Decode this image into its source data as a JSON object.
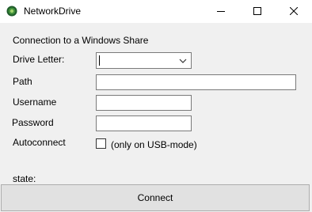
{
  "window": {
    "title": "NetworkDrive",
    "icon": "network-drive-app-icon",
    "controls": [
      "minimize-icon",
      "maximize-icon",
      "close-icon"
    ]
  },
  "form": {
    "heading": "Connection to a Windows Share",
    "drive_letter_label": "Drive Letter:",
    "drive_letter_value": "",
    "path_label": "Path",
    "path_value": "",
    "username_label": "Username",
    "username_value": "",
    "password_label": "Password",
    "password_value": "",
    "autoconnect_label": "Autoconnect",
    "autoconnect_checked": false,
    "autoconnect_note": "(only on USB-mode)",
    "state_label": "state:",
    "state_value": "",
    "connect_label": "Connect"
  },
  "colors": {
    "client_background": "#f0f0f0",
    "button_background": "#e1e1e1",
    "input_border": "#7a7a7a"
  }
}
